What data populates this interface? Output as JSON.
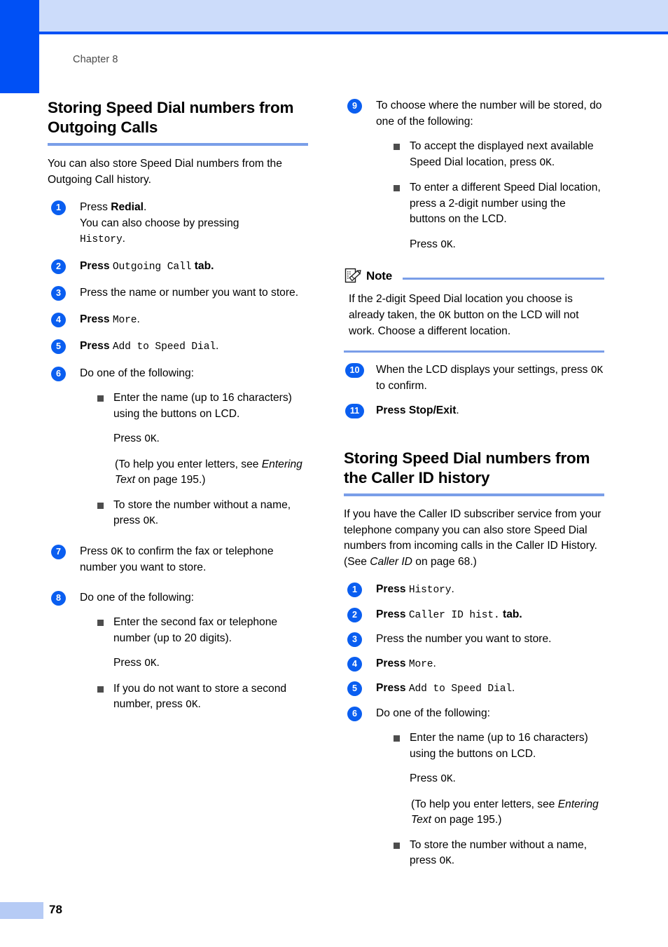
{
  "page": {
    "chapter_label": "Chapter 8",
    "page_number": "78",
    "accent_blue": "#0050f5",
    "band_blue": "#ccdcfa",
    "rule_blue": "#7a9ee8",
    "badge_blue": "#0a5ef0",
    "footer_bar_blue": "#b6cbf5"
  },
  "left_column": {
    "heading": "Storing Speed Dial numbers from Outgoing Calls",
    "intro": "You can also store Speed Dial numbers from the Outgoing Call history.",
    "steps": [
      {
        "number": "1",
        "line1_prefix": "Press ",
        "line1_bold": "Redial",
        "line1_suffix": ".",
        "line2": "You can also choose by pressing",
        "line3_lcd": "History",
        "line3_suffix": "."
      },
      {
        "number": "2",
        "prefix_bold": "Press ",
        "lcd": "Outgoing Call",
        "suffix_bold": " tab."
      },
      {
        "number": "3",
        "text": "Press the name or number you want to store."
      },
      {
        "number": "4",
        "prefix_bold": "Press ",
        "lcd": "More",
        "suffix": "."
      },
      {
        "number": "5",
        "prefix_bold": "Press ",
        "lcd": "Add to Speed Dial",
        "suffix": "."
      },
      {
        "number": "6",
        "text": "Do one of the following:",
        "bullets": [
          {
            "text": "Enter the name (up to 16 characters) using the buttons on LCD.",
            "sub_lines": [
              {
                "prefix": "Press ",
                "lcd": "OK",
                "suffix": "."
              },
              {
                "plain_pre": " (To help you enter letters, see ",
                "italic": "Entering Text",
                "plain_post": " on page 195.)"
              }
            ]
          },
          {
            "prefix": "To store the number without a name, press ",
            "lcd": "OK",
            "suffix": "."
          }
        ]
      },
      {
        "number": "7",
        "prefix": "Press ",
        "lcd": "OK",
        "suffix": " to confirm the fax or telephone number you want to store."
      },
      {
        "number": "8",
        "text": "Do one of the following:",
        "bullets": [
          {
            "text": "Enter the second fax or telephone number (up to 20 digits).",
            "sub_lines": [
              {
                "prefix": "Press ",
                "lcd": "OK",
                "suffix": "."
              }
            ]
          },
          {
            "prefix": "If you do not want to store a second number, press ",
            "lcd": "OK",
            "suffix": "."
          }
        ]
      }
    ]
  },
  "right_column": {
    "steps_top": [
      {
        "number": "9",
        "text": "To choose where the number will be stored, do one of the following:",
        "bullets": [
          {
            "prefix": "To accept the displayed next available Speed Dial location, press ",
            "lcd": "OK",
            "suffix": "."
          },
          {
            "text": "To enter a different Speed Dial location, press a 2-digit number using the buttons on the LCD.",
            "sub_lines": [
              {
                "prefix": "Press ",
                "lcd": "OK",
                "suffix": "."
              }
            ]
          }
        ]
      }
    ],
    "note": {
      "title": "Note",
      "icon": "note-pencil-icon",
      "body_pre": "If the 2-digit Speed Dial location you choose is already taken, the ",
      "body_lcd": "OK",
      "body_post": " button on the LCD will not work. Choose a different location."
    },
    "steps_after_note": [
      {
        "number": "10",
        "prefix": "When the LCD displays your settings, press ",
        "lcd": "OK",
        "suffix": " to confirm."
      },
      {
        "number": "11",
        "prefix_bold": "Press ",
        "bold_strong": "Stop/Exit",
        "suffix": "."
      }
    ],
    "heading": "Storing Speed Dial numbers from the Caller ID history",
    "intro_pre": "If you have the Caller ID subscriber service from your telephone company you can also store Speed Dial numbers from incoming calls in the Caller ID History. (See ",
    "intro_italic": "Caller ID",
    "intro_post": " on page 68.)",
    "steps_bottom": [
      {
        "number": "1",
        "prefix_bold": "Press ",
        "lcd": "History",
        "suffix": "."
      },
      {
        "number": "2",
        "prefix_bold": "Press ",
        "lcd": "Caller ID hist.",
        "suffix_bold": " tab."
      },
      {
        "number": "3",
        "text": "Press the number you want to store."
      },
      {
        "number": "4",
        "prefix_bold": "Press ",
        "lcd": "More",
        "suffix": "."
      },
      {
        "number": "5",
        "prefix_bold": "Press ",
        "lcd": "Add to Speed Dial",
        "suffix": "."
      },
      {
        "number": "6",
        "text": "Do one of the following:",
        "bullets": [
          {
            "text": "Enter the name (up to 16 characters) using the buttons on LCD.",
            "sub_lines": [
              {
                "prefix": "Press ",
                "lcd": "OK",
                "suffix": "."
              },
              {
                "plain_pre": " (To help you enter letters, see ",
                "italic": "Entering Text",
                "plain_post": " on page 195.)"
              }
            ]
          },
          {
            "prefix": "To store the number without a name, press ",
            "lcd": "OK",
            "suffix": "."
          }
        ]
      }
    ]
  }
}
